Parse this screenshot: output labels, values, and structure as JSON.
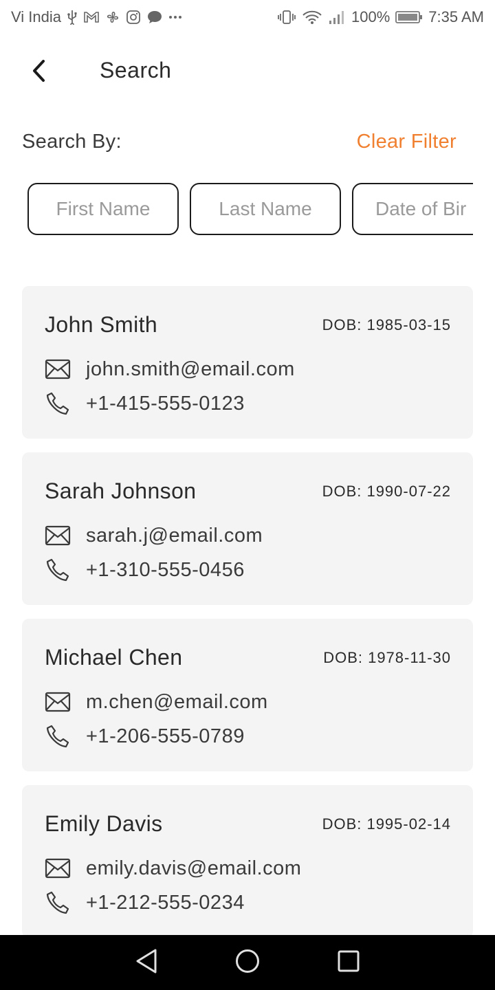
{
  "status_bar": {
    "carrier": "Vi India",
    "battery": "100%",
    "time": "7:35 AM",
    "icons": [
      "usb-icon",
      "gmail-icon",
      "fan-icon",
      "instagram-icon",
      "message-icon",
      "more-icon",
      "vibrate-icon",
      "wifi-icon",
      "signal-icon",
      "battery-icon"
    ]
  },
  "header": {
    "title": "Search",
    "back_icon": "chevron-left-icon"
  },
  "filters": {
    "label": "Search By:",
    "clear_label": "Clear Filter",
    "accent_color": "#f08030",
    "chips": [
      {
        "label": "First Name"
      },
      {
        "label": "Last Name"
      },
      {
        "label": "Date of Bir"
      }
    ]
  },
  "results": [
    {
      "name": "John Smith",
      "dob": "DOB: 1985-03-15",
      "email": "john.smith@email.com",
      "phone": "+1-415-555-0123"
    },
    {
      "name": "Sarah Johnson",
      "dob": "DOB: 1990-07-22",
      "email": "sarah.j@email.com",
      "phone": "+1-310-555-0456"
    },
    {
      "name": "Michael Chen",
      "dob": "DOB: 1978-11-30",
      "email": "m.chen@email.com",
      "phone": "+1-206-555-0789"
    },
    {
      "name": "Emily Davis",
      "dob": "DOB: 1995-02-14",
      "email": "emily.davis@email.com",
      "phone": "+1-212-555-0234"
    }
  ],
  "nav_bar": {
    "buttons": [
      "back-triangle-icon",
      "home-circle-icon",
      "recents-square-icon"
    ]
  }
}
